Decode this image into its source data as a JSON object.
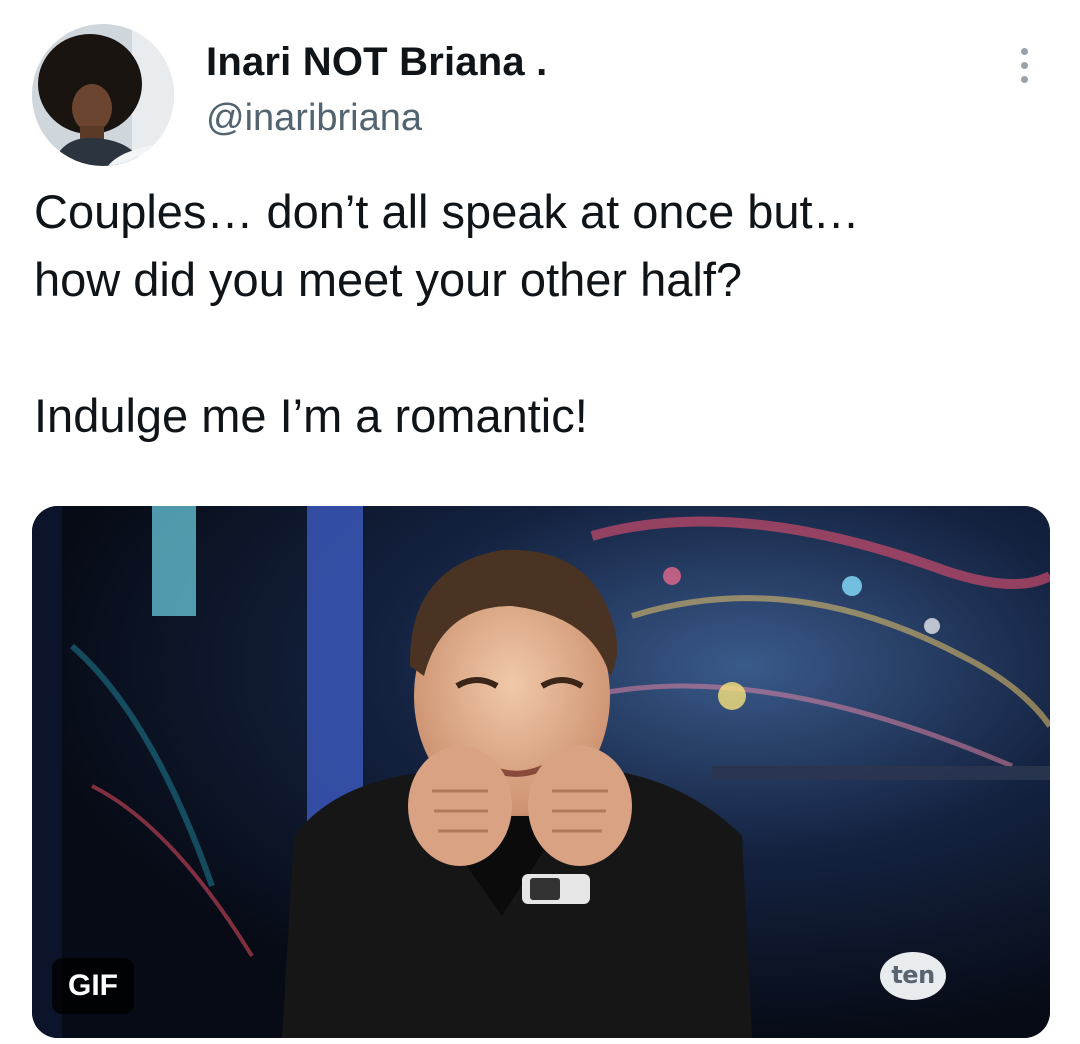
{
  "author": {
    "display_name": "Inari NOT Briana .",
    "handle": "@inaribriana",
    "avatar_icon": "profile-photo"
  },
  "tweet": {
    "lines": [
      "Couples… don’t all speak at once but…",
      "how did you meet your other half?",
      "Indulge me I’m a romantic!"
    ]
  },
  "media": {
    "badge": "GIF",
    "watermark": "ten"
  },
  "menu": {
    "icon": "more-options-icon"
  },
  "colors": {
    "text": "#0f1419",
    "secondary_text": "#536471",
    "menu_dots": "#98a2ab"
  }
}
